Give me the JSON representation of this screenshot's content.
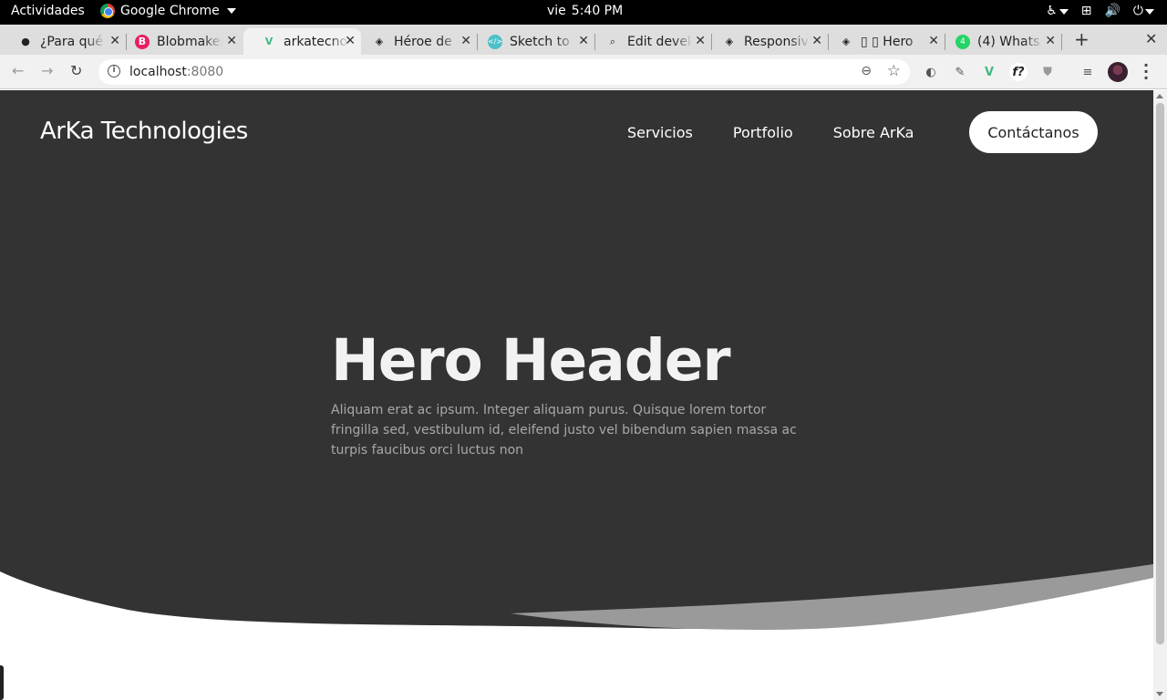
{
  "system_bar": {
    "activities": "Actividades",
    "app_name": "Google Chrome",
    "day": "vie",
    "time": "5:40 PM"
  },
  "tabs": [
    {
      "title": "¿Para qué",
      "icon": "globe-icon"
    },
    {
      "title": "Blobmaker",
      "icon": "blobmaker-icon"
    },
    {
      "title": "arkatecnol",
      "icon": "vue-icon",
      "active": true
    },
    {
      "title": "Héroe de",
      "icon": "codepen-icon"
    },
    {
      "title": "Sketch to",
      "icon": "sketch-icon"
    },
    {
      "title": "Edit devel",
      "icon": "search-icon"
    },
    {
      "title": "Responsiv",
      "icon": "codepen-icon"
    },
    {
      "title": "▯ ▯ Hero",
      "icon": "codepen-icon"
    },
    {
      "title": "(4) Whats",
      "icon": "whatsapp-icon"
    }
  ],
  "address_bar": {
    "host": "localhost",
    "port": ":8080"
  },
  "page": {
    "brand": "ArKa Technologies",
    "nav": {
      "services": "Servicios",
      "portfolio": "Portfolio",
      "about": "Sobre ArKa"
    },
    "cta": "Contáctanos",
    "hero_title": "Hero Header",
    "hero_text": "Aliquam erat ac ipsum. Integer aliquam purus. Quisque lorem tortor fringilla sed, vestibulum id, eleifend justo vel bibendum sapien massa ac turpis faucibus orci luctus non"
  },
  "colors": {
    "hero_bg": "#333333",
    "wave_back": "#9a9a9a",
    "accent_text": "#f2f2f2"
  }
}
